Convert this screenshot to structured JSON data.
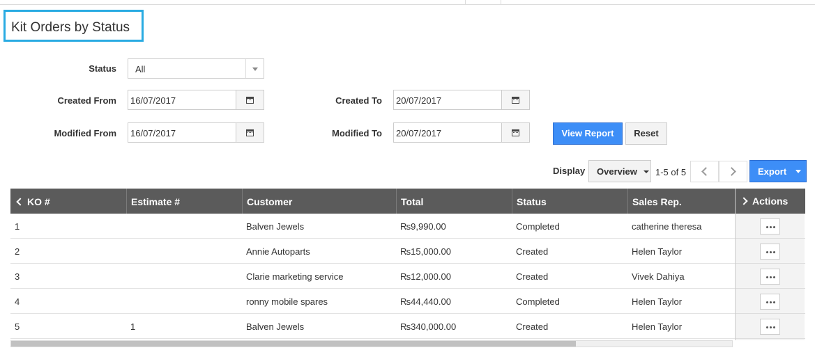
{
  "page": {
    "title": "Kit Orders by Status"
  },
  "filters": {
    "status_label": "Status",
    "status_value": "All",
    "created_from_label": "Created From",
    "created_from_value": "16/07/2017",
    "created_to_label": "Created To",
    "created_to_value": "20/07/2017",
    "modified_from_label": "Modified From",
    "modified_from_value": "16/07/2017",
    "modified_to_label": "Modified To",
    "modified_to_value": "20/07/2017",
    "view_report_label": "View Report",
    "reset_label": "Reset"
  },
  "toolbar": {
    "display_label": "Display",
    "display_value": "Overview",
    "pager_text": "1-5 of 5",
    "export_label": "Export"
  },
  "table": {
    "columns": [
      "KO #",
      "Estimate #",
      "Customer",
      "Total",
      "Status",
      "Sales Rep.",
      "Actions"
    ],
    "rows": [
      {
        "ko": "1",
        "estimate": "",
        "customer": "Balven Jewels",
        "total": "₨9,990.00",
        "status": "Completed",
        "sales_rep": "catherine theresa"
      },
      {
        "ko": "2",
        "estimate": "",
        "customer": "Annie Autoparts",
        "total": "₨15,000.00",
        "status": "Created",
        "sales_rep": "Helen Taylor"
      },
      {
        "ko": "3",
        "estimate": "",
        "customer": "Clarie marketing service",
        "total": "₨12,000.00",
        "status": "Created",
        "sales_rep": "Vivek Dahiya"
      },
      {
        "ko": "4",
        "estimate": "",
        "customer": "ronny mobile spares",
        "total": "₨44,440.00",
        "status": "Completed",
        "sales_rep": "Helen Taylor"
      },
      {
        "ko": "5",
        "estimate": "1",
        "customer": "Balven Jewels",
        "total": "₨340,000.00",
        "status": "Created",
        "sales_rep": "Helen Taylor"
      }
    ]
  },
  "icons": {
    "calendar": "calendar-icon",
    "dropdown": "chevron-down-icon",
    "prev": "chevron-left-icon",
    "next": "chevron-right-icon",
    "more": "ellipsis-icon"
  },
  "colors": {
    "title_highlight": "#29abe2",
    "primary": "#3d8ef7",
    "table_header": "#5b5b5b"
  }
}
